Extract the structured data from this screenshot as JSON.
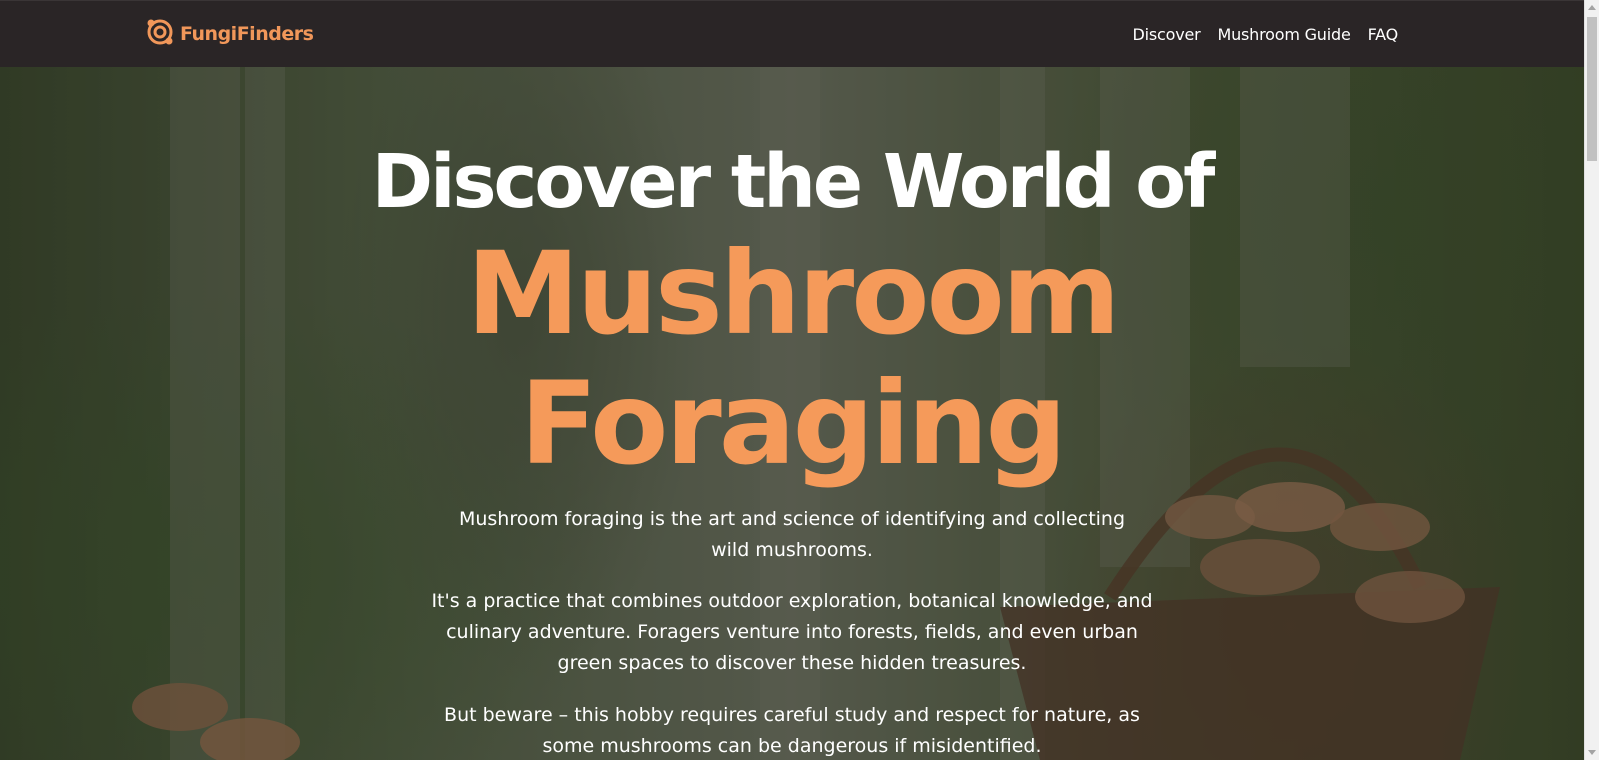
{
  "brand": {
    "name": "FungiFinders",
    "logo_icon": "mushroom-logo-icon",
    "color": "#f1975a"
  },
  "nav": {
    "links": [
      {
        "label": "Discover"
      },
      {
        "label": "Mushroom Guide"
      },
      {
        "label": "FAQ"
      }
    ]
  },
  "hero": {
    "title_line1": "Discover the World of",
    "title_line2": "Mushroom",
    "title_line3": "Foraging",
    "accent_color": "#f59a5a",
    "paragraphs": [
      "Mushroom foraging is the art and science of identifying and collecting wild mushrooms.",
      "It's a practice that combines outdoor exploration, botanical knowledge, and culinary adventure. Foragers venture into forests, fields, and even urban green spaces to discover these hidden treasures.",
      "But beware – this hobby requires careful study and respect for nature, as some mushrooms can be dangerous if misidentified."
    ]
  }
}
